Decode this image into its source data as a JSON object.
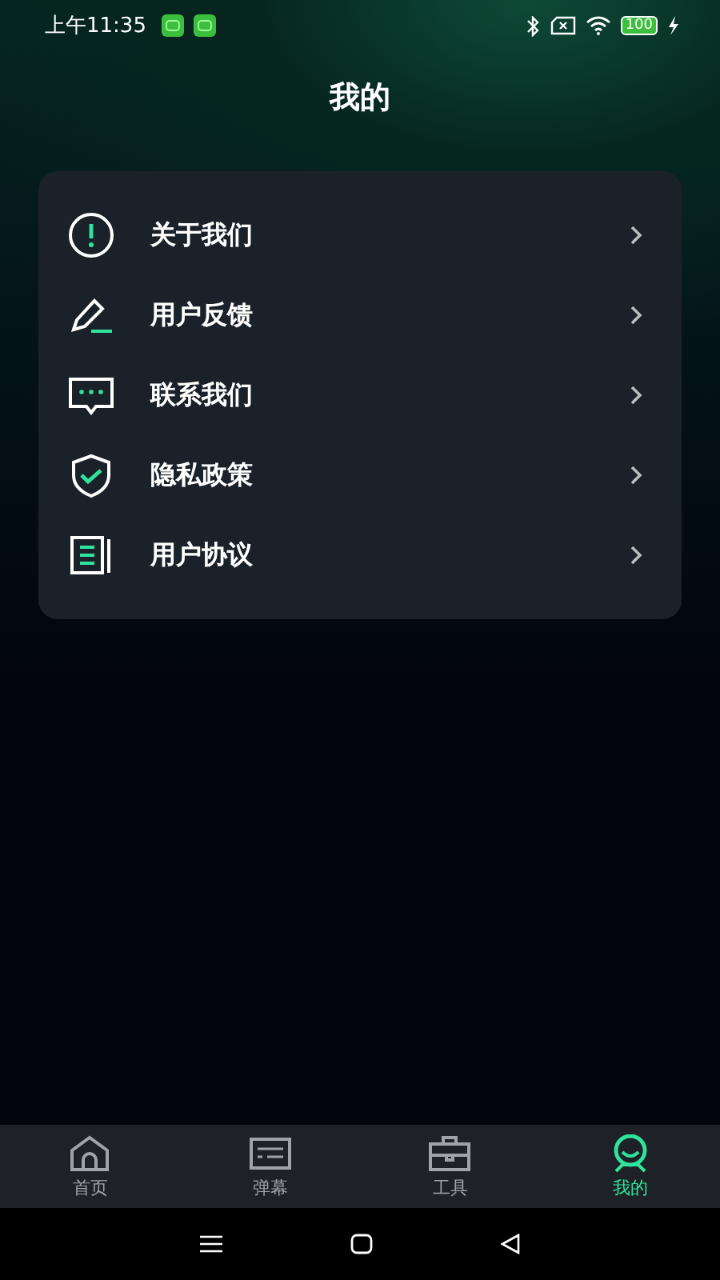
{
  "status_bar": {
    "time": "上午11:35",
    "battery": "100"
  },
  "title": "我的",
  "menu": [
    {
      "kind": "about",
      "label": "关于我们"
    },
    {
      "kind": "feedback",
      "label": "用户反馈"
    },
    {
      "kind": "contact",
      "label": "联系我们"
    },
    {
      "kind": "privacy",
      "label": "隐私政策"
    },
    {
      "kind": "agreement",
      "label": "用户协议"
    }
  ],
  "tabs": [
    {
      "kind": "home",
      "label": "首页",
      "selected": false
    },
    {
      "kind": "danmaku",
      "label": "弹幕",
      "selected": false
    },
    {
      "kind": "tools",
      "label": "工具",
      "selected": false
    },
    {
      "kind": "mine",
      "label": "我的",
      "selected": true
    }
  ]
}
